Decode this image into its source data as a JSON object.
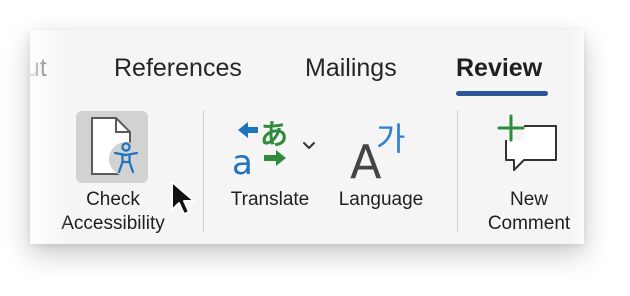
{
  "tabs": [
    {
      "label": "out"
    },
    {
      "label": "References"
    },
    {
      "label": "Mailings"
    },
    {
      "label": "Review"
    }
  ],
  "buttons": {
    "check_accessibility": {
      "line1": "Check",
      "line2": "Accessibility",
      "icon": "accessibility-check-icon"
    },
    "translate": {
      "label": "Translate",
      "icon": "translate-icon",
      "dropdown_icon": "chevron-down-icon"
    },
    "language": {
      "label": "Language",
      "icon": "language-icon"
    },
    "new_comment": {
      "line1": "New",
      "line2": "Comment",
      "icon": "new-comment-icon"
    }
  },
  "colors": {
    "accent": "#2b579a",
    "translate_blue": "#1e73be",
    "translate_green": "#2e8b3d",
    "comment_plus": "#2e8b3d",
    "language_blue": "#2f80d0"
  },
  "cursor": {
    "icon": "mouse-pointer-icon"
  }
}
